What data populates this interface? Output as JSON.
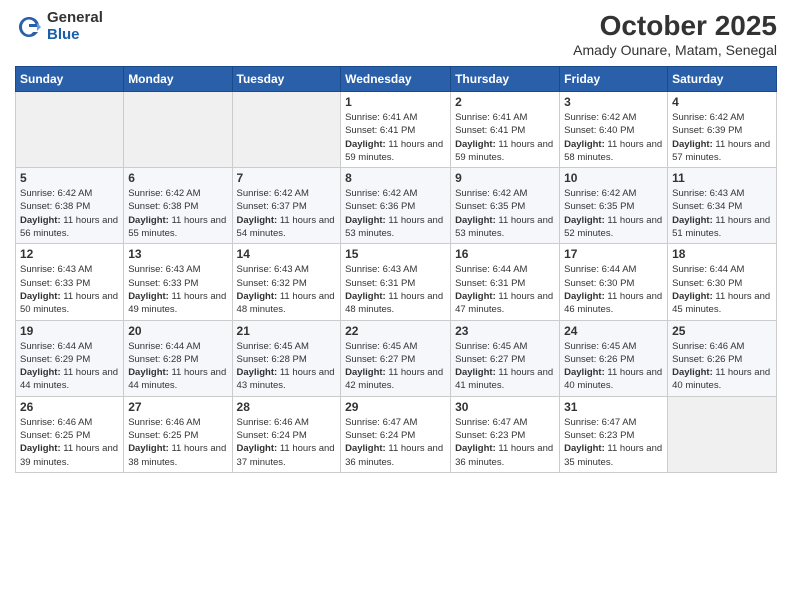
{
  "logo": {
    "general": "General",
    "blue": "Blue"
  },
  "header": {
    "month": "October 2025",
    "location": "Amady Ounare, Matam, Senegal"
  },
  "days_of_week": [
    "Sunday",
    "Monday",
    "Tuesday",
    "Wednesday",
    "Thursday",
    "Friday",
    "Saturday"
  ],
  "weeks": [
    [
      {
        "day": "",
        "info": ""
      },
      {
        "day": "",
        "info": ""
      },
      {
        "day": "",
        "info": ""
      },
      {
        "day": "1",
        "info": "Sunrise: 6:41 AM\nSunset: 6:41 PM\nDaylight: 11 hours and 59 minutes."
      },
      {
        "day": "2",
        "info": "Sunrise: 6:41 AM\nSunset: 6:41 PM\nDaylight: 11 hours and 59 minutes."
      },
      {
        "day": "3",
        "info": "Sunrise: 6:42 AM\nSunset: 6:40 PM\nDaylight: 11 hours and 58 minutes."
      },
      {
        "day": "4",
        "info": "Sunrise: 6:42 AM\nSunset: 6:39 PM\nDaylight: 11 hours and 57 minutes."
      }
    ],
    [
      {
        "day": "5",
        "info": "Sunrise: 6:42 AM\nSunset: 6:38 PM\nDaylight: 11 hours and 56 minutes."
      },
      {
        "day": "6",
        "info": "Sunrise: 6:42 AM\nSunset: 6:38 PM\nDaylight: 11 hours and 55 minutes."
      },
      {
        "day": "7",
        "info": "Sunrise: 6:42 AM\nSunset: 6:37 PM\nDaylight: 11 hours and 54 minutes."
      },
      {
        "day": "8",
        "info": "Sunrise: 6:42 AM\nSunset: 6:36 PM\nDaylight: 11 hours and 53 minutes."
      },
      {
        "day": "9",
        "info": "Sunrise: 6:42 AM\nSunset: 6:35 PM\nDaylight: 11 hours and 53 minutes."
      },
      {
        "day": "10",
        "info": "Sunrise: 6:42 AM\nSunset: 6:35 PM\nDaylight: 11 hours and 52 minutes."
      },
      {
        "day": "11",
        "info": "Sunrise: 6:43 AM\nSunset: 6:34 PM\nDaylight: 11 hours and 51 minutes."
      }
    ],
    [
      {
        "day": "12",
        "info": "Sunrise: 6:43 AM\nSunset: 6:33 PM\nDaylight: 11 hours and 50 minutes."
      },
      {
        "day": "13",
        "info": "Sunrise: 6:43 AM\nSunset: 6:33 PM\nDaylight: 11 hours and 49 minutes."
      },
      {
        "day": "14",
        "info": "Sunrise: 6:43 AM\nSunset: 6:32 PM\nDaylight: 11 hours and 48 minutes."
      },
      {
        "day": "15",
        "info": "Sunrise: 6:43 AM\nSunset: 6:31 PM\nDaylight: 11 hours and 48 minutes."
      },
      {
        "day": "16",
        "info": "Sunrise: 6:44 AM\nSunset: 6:31 PM\nDaylight: 11 hours and 47 minutes."
      },
      {
        "day": "17",
        "info": "Sunrise: 6:44 AM\nSunset: 6:30 PM\nDaylight: 11 hours and 46 minutes."
      },
      {
        "day": "18",
        "info": "Sunrise: 6:44 AM\nSunset: 6:30 PM\nDaylight: 11 hours and 45 minutes."
      }
    ],
    [
      {
        "day": "19",
        "info": "Sunrise: 6:44 AM\nSunset: 6:29 PM\nDaylight: 11 hours and 44 minutes."
      },
      {
        "day": "20",
        "info": "Sunrise: 6:44 AM\nSunset: 6:28 PM\nDaylight: 11 hours and 44 minutes."
      },
      {
        "day": "21",
        "info": "Sunrise: 6:45 AM\nSunset: 6:28 PM\nDaylight: 11 hours and 43 minutes."
      },
      {
        "day": "22",
        "info": "Sunrise: 6:45 AM\nSunset: 6:27 PM\nDaylight: 11 hours and 42 minutes."
      },
      {
        "day": "23",
        "info": "Sunrise: 6:45 AM\nSunset: 6:27 PM\nDaylight: 11 hours and 41 minutes."
      },
      {
        "day": "24",
        "info": "Sunrise: 6:45 AM\nSunset: 6:26 PM\nDaylight: 11 hours and 40 minutes."
      },
      {
        "day": "25",
        "info": "Sunrise: 6:46 AM\nSunset: 6:26 PM\nDaylight: 11 hours and 40 minutes."
      }
    ],
    [
      {
        "day": "26",
        "info": "Sunrise: 6:46 AM\nSunset: 6:25 PM\nDaylight: 11 hours and 39 minutes."
      },
      {
        "day": "27",
        "info": "Sunrise: 6:46 AM\nSunset: 6:25 PM\nDaylight: 11 hours and 38 minutes."
      },
      {
        "day": "28",
        "info": "Sunrise: 6:46 AM\nSunset: 6:24 PM\nDaylight: 11 hours and 37 minutes."
      },
      {
        "day": "29",
        "info": "Sunrise: 6:47 AM\nSunset: 6:24 PM\nDaylight: 11 hours and 36 minutes."
      },
      {
        "day": "30",
        "info": "Sunrise: 6:47 AM\nSunset: 6:23 PM\nDaylight: 11 hours and 36 minutes."
      },
      {
        "day": "31",
        "info": "Sunrise: 6:47 AM\nSunset: 6:23 PM\nDaylight: 11 hours and 35 minutes."
      },
      {
        "day": "",
        "info": ""
      }
    ]
  ]
}
